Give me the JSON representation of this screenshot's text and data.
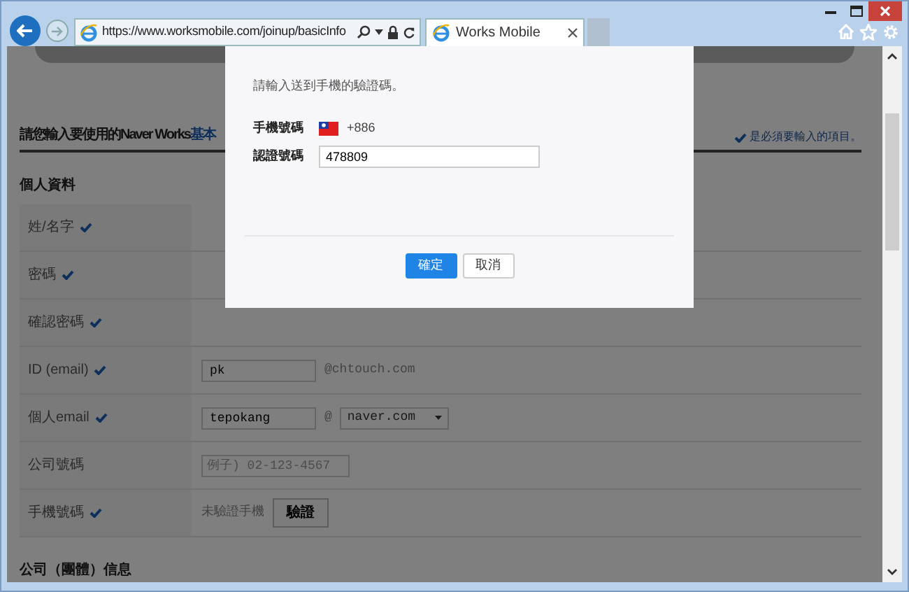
{
  "browser": {
    "url": "https://www.worksmobile.com/joinup/basicInfo",
    "tabs": [
      {
        "title": "Works Mobile",
        "selected": true
      }
    ]
  },
  "page": {
    "intro": "請您輸入要使用的Naver Works",
    "intro_link": "基本",
    "required_note": "是必須要輸入的項目。",
    "sections": [
      {
        "title": "個人資料",
        "rows": [
          {
            "label": "姓/名字",
            "required": true,
            "kind": "blank"
          },
          {
            "label": "密碼",
            "required": true,
            "kind": "blank"
          },
          {
            "label": "確認密碼",
            "required": true,
            "kind": "blank"
          },
          {
            "label": "ID (email)",
            "required": true,
            "kind": "email_id",
            "value": "pk",
            "suffix": "@chtouch.com"
          },
          {
            "label": "個人email",
            "required": true,
            "kind": "email",
            "value": "tepokang",
            "at": "@",
            "domain": "naver.com"
          },
          {
            "label": "公司號碼",
            "required": false,
            "kind": "phone",
            "placeholder": "例子) 02-123-4567"
          },
          {
            "label": "手機號碼",
            "required": true,
            "kind": "verify",
            "status": "未驗證手機",
            "button": "驗證"
          }
        ]
      },
      {
        "title": "公司（團體）信息"
      }
    ]
  },
  "modal": {
    "message": "請輸入送到手機的驗證碼。",
    "fields": [
      {
        "label": "手機號碼",
        "kind": "phone",
        "prefix": "+886"
      },
      {
        "label": "認證號碼",
        "kind": "input",
        "value": "478809"
      }
    ],
    "buttons": [
      {
        "label": "確定",
        "primary": true
      },
      {
        "label": "取消",
        "primary": false
      }
    ]
  }
}
